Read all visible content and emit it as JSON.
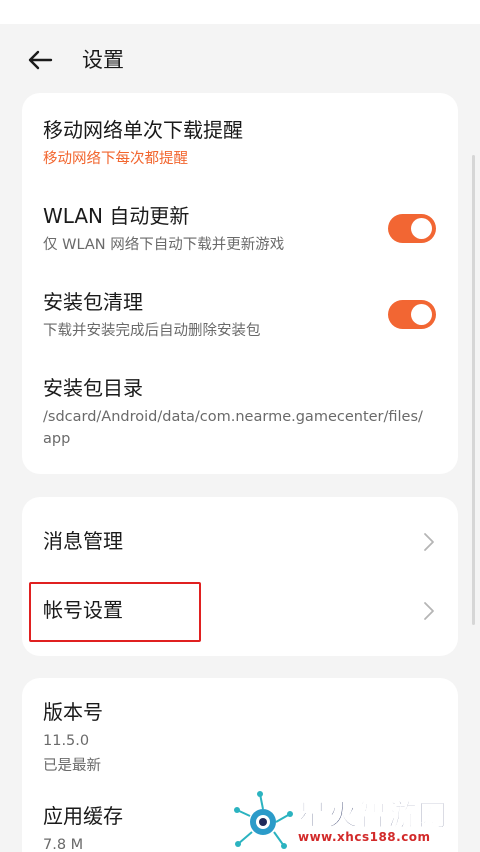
{
  "header": {
    "title": "设置"
  },
  "download": {
    "mobile_prompt": {
      "label": "移动网络单次下载提醒",
      "value": "移动网络下每次都提醒"
    },
    "wlan_update": {
      "label": "WLAN 自动更新",
      "desc": "仅 WLAN 网络下自动下载并更新游戏",
      "enabled": true
    },
    "package_clean": {
      "label": "安装包清理",
      "desc": "下载并安装完成后自动删除安装包",
      "enabled": true
    },
    "package_dir": {
      "label": "安装包目录",
      "path_line1": "/sdcard/Android/data/com.nearme.gamecenter/files/",
      "path_line2": "app"
    }
  },
  "nav": {
    "messages": {
      "label": "消息管理"
    },
    "account": {
      "label": "帐号设置"
    }
  },
  "about": {
    "version": {
      "label": "版本号",
      "value": "11.5.0",
      "status": "已是最新"
    },
    "cache": {
      "label": "应用缓存",
      "value": "7.8 M"
    }
  },
  "watermark": {
    "brand": "星火智游网",
    "url": "www.xhcs188.com"
  },
  "colors": {
    "accent": "#f26633",
    "highlight": "#e02020",
    "background": "#f4f4f4"
  },
  "icons": {
    "back": "arrow-left-icon",
    "chevron": "chevron-right-icon"
  }
}
